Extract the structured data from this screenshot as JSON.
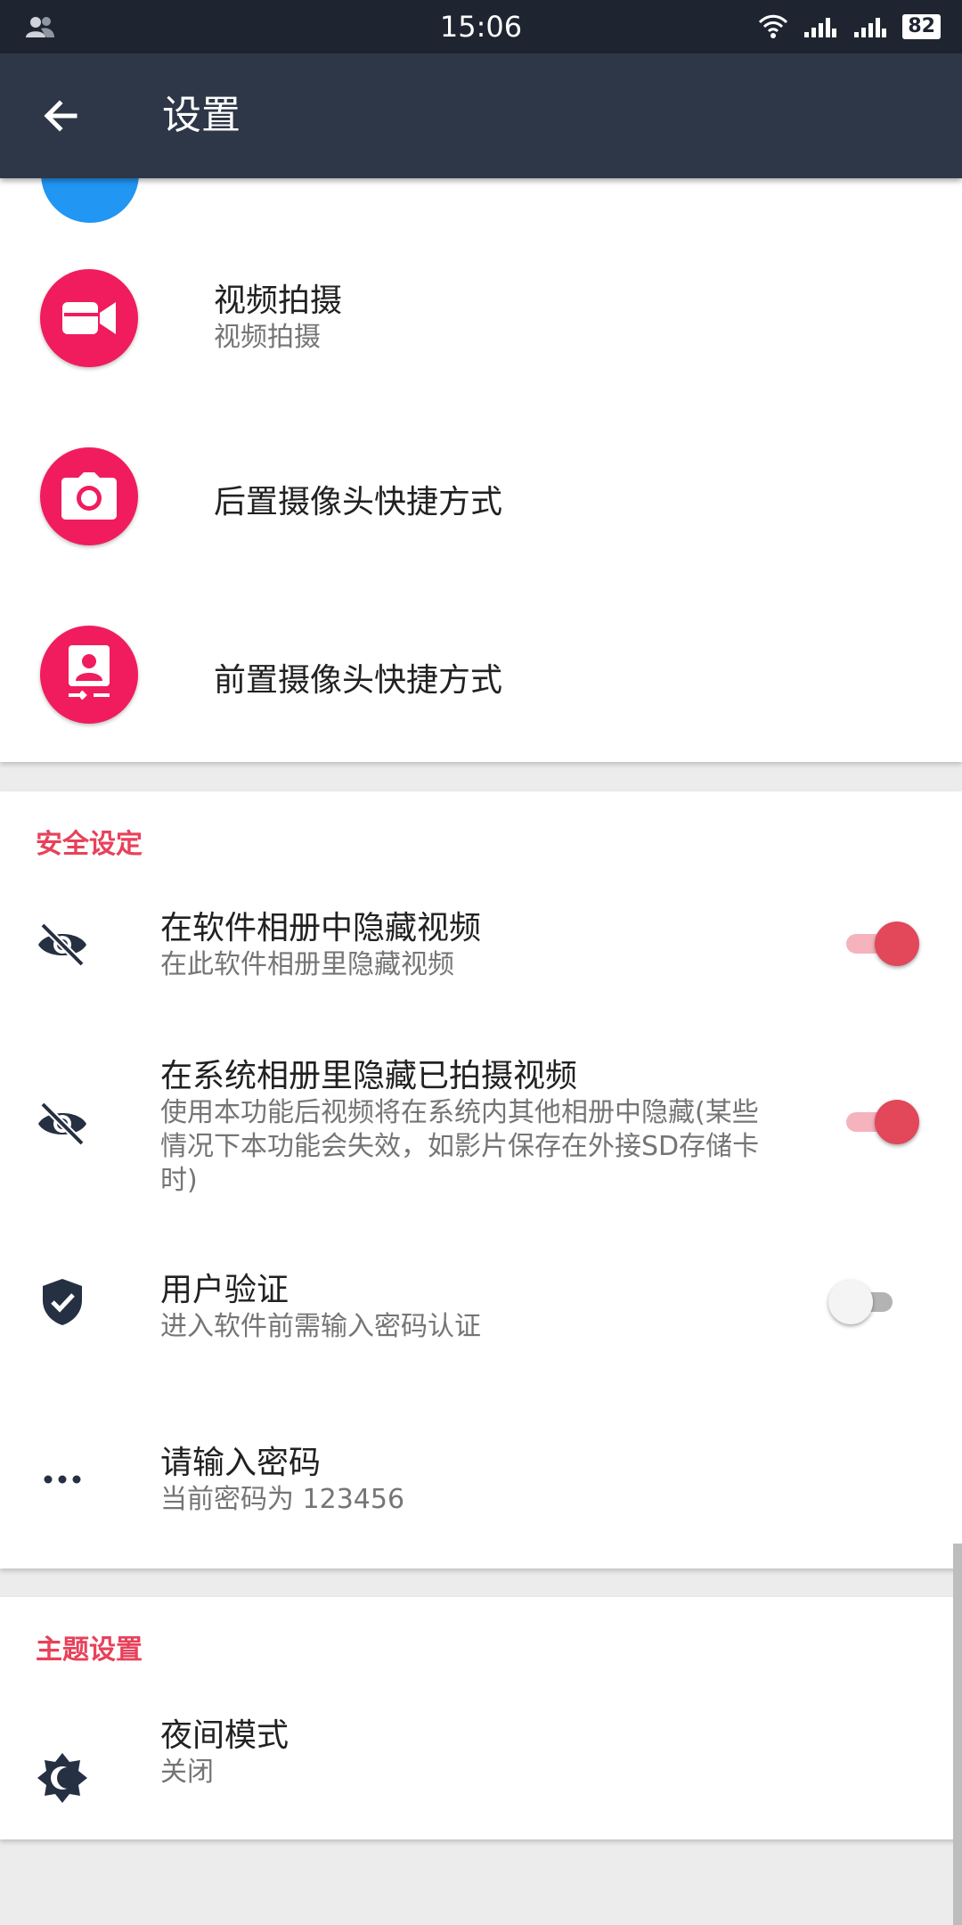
{
  "status_bar": {
    "time": "15:06",
    "battery": "82"
  },
  "app_bar": {
    "title": "设置"
  },
  "shortcuts": [
    {
      "title": "视频拍摄",
      "subtitle": "视频拍摄",
      "icon": "video-camera-icon"
    },
    {
      "title": "后置摄像头快捷方式",
      "icon": "camera-icon"
    },
    {
      "title": "前置摄像头快捷方式",
      "icon": "front-camera-icon"
    }
  ],
  "security": {
    "header": "安全设定",
    "items": [
      {
        "title": "在软件相册中隐藏视频",
        "subtitle": "在此软件相册里隐藏视频",
        "icon": "eye-off-icon",
        "toggle": true
      },
      {
        "title": "在系统相册里隐藏已拍摄视频",
        "subtitle": "使用本功能后视频将在系统内其他相册中隐藏(某些情况下本功能会失效，如影片保存在外接SD存储卡时)",
        "icon": "eye-off-icon",
        "toggle": true
      },
      {
        "title": "用户验证",
        "subtitle": "进入软件前需输入密码认证",
        "icon": "shield-check-icon",
        "toggle": false
      },
      {
        "title": "请输入密码",
        "subtitle": "当前密码为 123456",
        "icon": "more-dots-icon"
      }
    ]
  },
  "theme": {
    "header": "主题设置",
    "items": [
      {
        "title": "夜间模式",
        "subtitle": "关闭",
        "icon": "brightness-icon"
      }
    ]
  },
  "colors": {
    "accent": "#e2475a",
    "app_bar": "#2e3747",
    "status_bar": "#1f2530",
    "shortcut_icon": "#f01c5e"
  }
}
